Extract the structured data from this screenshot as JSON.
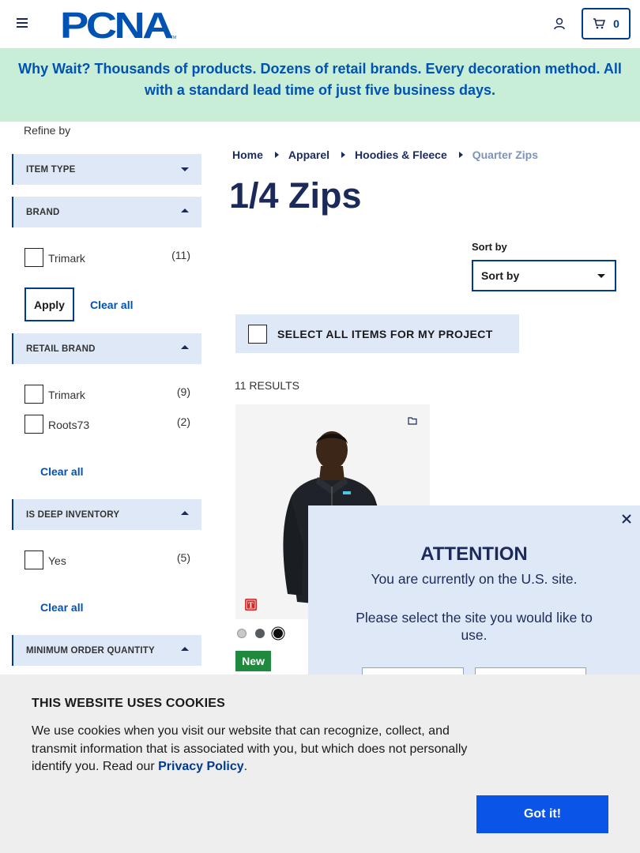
{
  "header": {
    "logo_text": "PCNA",
    "cart_count": "0"
  },
  "banner": {
    "text": "Why Wait? Thousands of products. Dozens of retail brands. Every decoration method. All with a standard lead time of just five business days."
  },
  "sidebar": {
    "refine_label": "Refine by",
    "facets": {
      "item_type": {
        "title": "ITEM TYPE"
      },
      "brand": {
        "title": "BRAND",
        "options": [
          {
            "label": "Trimark",
            "count": "(11)"
          }
        ],
        "apply_label": "Apply",
        "clear_label": "Clear all"
      },
      "retail_brand": {
        "title": "RETAIL BRAND",
        "options": [
          {
            "label": "Trimark",
            "count": "(9)"
          },
          {
            "label": "Roots73",
            "count": "(2)"
          }
        ],
        "clear_label": "Clear all"
      },
      "deep_inventory": {
        "title": "IS DEEP INVENTORY",
        "options": [
          {
            "label": "Yes",
            "count": "(5)"
          }
        ],
        "clear_label": "Clear all"
      },
      "min_order": {
        "title": "MINIMUM ORDER QUANTITY"
      }
    }
  },
  "breadcrumb": {
    "items": [
      "Home",
      "Apparel",
      "Hoodies & Fleece"
    ],
    "current": "Quarter Zips"
  },
  "main": {
    "title": "1/4 Zips",
    "sort_label": "Sort by",
    "sort_value": "Sort by",
    "select_all_label": "SELECT ALL ITEMS FOR MY PROJECT",
    "results_label": "11 RESULTS"
  },
  "product": {
    "badge": "New",
    "swatches": [
      "#c8c8c8",
      "#555a60",
      "#0d0d12"
    ],
    "brand_icon": "trimark-icon"
  },
  "modal": {
    "title": "ATTENTION",
    "line1": "You are currently on the U.S. site.",
    "line2": "Please select the site you would like to use."
  },
  "cookie": {
    "title": "THIS WEBSITE USES COOKIES",
    "text": "We use cookies when you visit our website that can recognize, collect, and transmit information that is associated with you, but which does not personally identify you. Read our",
    "link": "Privacy Policy",
    "period": ".",
    "button": "Got it!"
  },
  "colors": {
    "brand_navy": "#1b2a5a",
    "brand_blue": "#003b8e",
    "banner_bg": "#c9eed7",
    "facet_bg": "#dfe8f6",
    "new_badge": "#1f8a3e",
    "cookie_button": "#0a55e8"
  }
}
